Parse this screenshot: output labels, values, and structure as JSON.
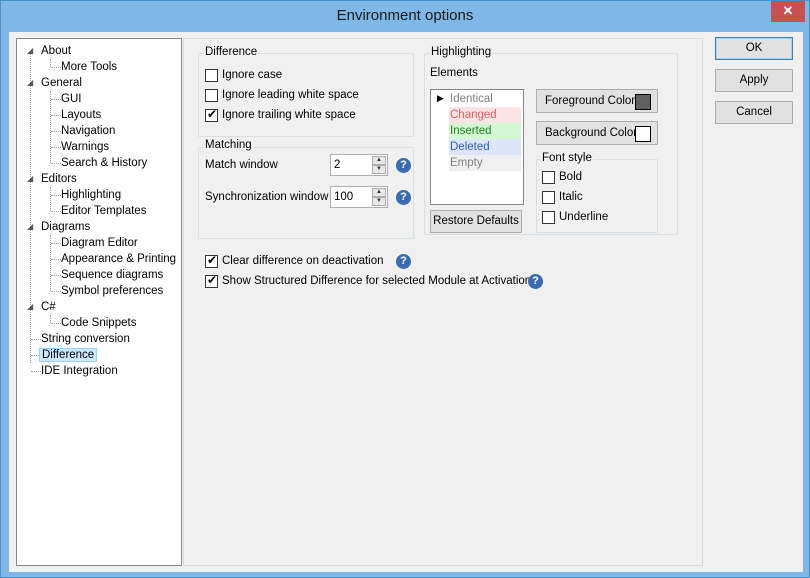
{
  "window": {
    "title": "Environment options",
    "close_glyph": "✕"
  },
  "tree": {
    "items": [
      {
        "label": "About",
        "arrow": "◢"
      },
      {
        "label": "More Tools"
      },
      {
        "label": "General",
        "arrow": "◢"
      },
      {
        "label": "GUI"
      },
      {
        "label": "Layouts"
      },
      {
        "label": "Navigation"
      },
      {
        "label": "Warnings"
      },
      {
        "label": "Search & History"
      },
      {
        "label": "Editors",
        "arrow": "◢"
      },
      {
        "label": "Highlighting"
      },
      {
        "label": "Editor Templates"
      },
      {
        "label": "Diagrams",
        "arrow": "◢"
      },
      {
        "label": "Diagram Editor"
      },
      {
        "label": "Appearance & Printing"
      },
      {
        "label": "Sequence diagrams"
      },
      {
        "label": "Symbol preferences"
      },
      {
        "label": "C#",
        "arrow": "◢"
      },
      {
        "label": "Code Snippets"
      },
      {
        "label": "String conversion"
      },
      {
        "label": "Difference",
        "selected": true
      },
      {
        "label": "IDE Integration"
      }
    ]
  },
  "difference": {
    "group_label": "Difference",
    "ignore_case": {
      "label": "Ignore case",
      "checked": false
    },
    "ignore_leading": {
      "label": "Ignore leading white space",
      "checked": false
    },
    "ignore_trailing": {
      "label": "Ignore trailing white space",
      "checked": true
    }
  },
  "matching": {
    "group_label": "Matching",
    "match_window_label": "Match window",
    "match_window_value": "2",
    "sync_window_label": "Synchronization window",
    "sync_window_value": "100"
  },
  "highlighting": {
    "group_label": "Highlighting",
    "elements_label": "Elements",
    "elements": [
      {
        "label": "Identical",
        "color": "#808080",
        "bg": "#ffffff"
      },
      {
        "label": "Changed",
        "color": "#e06060",
        "bg": "#fde4e4"
      },
      {
        "label": "Inserted",
        "color": "#208020",
        "bg": "#d4f7d4"
      },
      {
        "label": "Deleted",
        "color": "#3060c0",
        "bg": "#dce6f8"
      },
      {
        "label": "Empty",
        "color": "#808080",
        "bg": "#f0f0f0"
      }
    ],
    "foreground_button": "Foreground Color",
    "foreground_color": "#606060",
    "background_button": "Background Color",
    "background_color": "#ffffff",
    "restore_button": "Restore Defaults",
    "font_style_label": "Font style",
    "bold": {
      "label": "Bold",
      "checked": false
    },
    "italic": {
      "label": "Italic",
      "checked": false
    },
    "underline": {
      "label": "Underline",
      "checked": false
    }
  },
  "options": {
    "clear_diff": {
      "label": "Clear difference on deactivation",
      "checked": true
    },
    "show_structured": {
      "label": "Show Structured Difference for selected Module at Activation",
      "checked": true
    }
  },
  "buttons": {
    "ok": "OK",
    "apply": "Apply",
    "cancel": "Cancel"
  },
  "help_glyph": "?"
}
